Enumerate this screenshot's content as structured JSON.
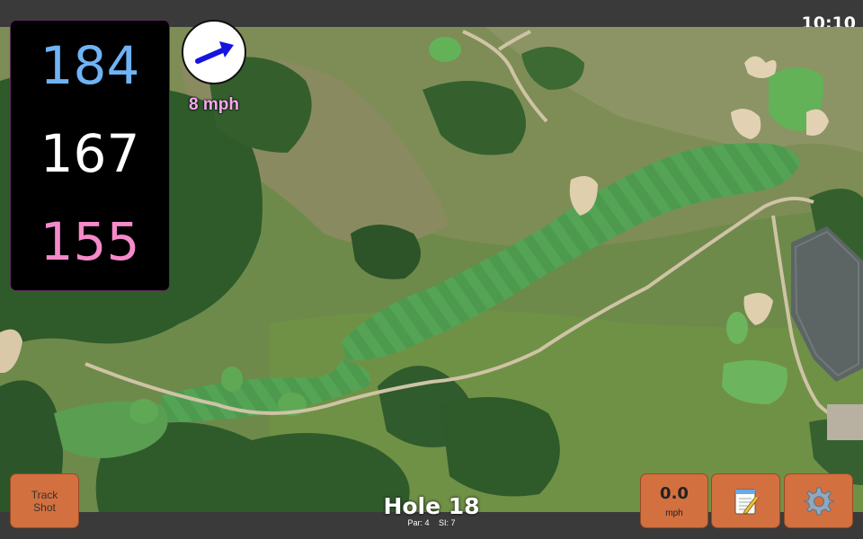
{
  "status_bar": {
    "time": "10:10"
  },
  "distances": {
    "back": {
      "value": "184",
      "color": "#6fb3f5"
    },
    "middle": {
      "value": "167",
      "color": "#ffffff"
    },
    "front": {
      "value": "155",
      "color": "#f58acb"
    }
  },
  "wind": {
    "speed_label": "8 mph",
    "speed_color": "#f7a8ef",
    "arrow_color": "#1515e0"
  },
  "track_button": {
    "label_line1": "Track",
    "label_line2": "Shot"
  },
  "speed_button": {
    "value": "0.0",
    "unit": "mph"
  },
  "notes_button": {
    "icon": "notepad-icon"
  },
  "settings_button": {
    "icon": "gear-icon"
  },
  "hole": {
    "title": "Hole 18",
    "par": "Par: 4",
    "stroke_index": "SI: 7"
  },
  "colors": {
    "button": "#d3703f",
    "panel": "#000000",
    "bars": "#3a3a3a"
  }
}
